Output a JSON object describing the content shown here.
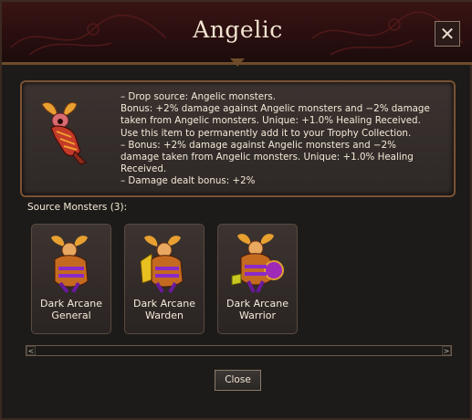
{
  "dialog": {
    "title": "Angelic",
    "close_icon": "close-icon"
  },
  "item": {
    "icon": "angelic-trophy-icon",
    "description_lines": [
      "– Drop source: Angelic monsters.",
      "Bonus: +2% damage against Angelic monsters and −2% damage",
      "taken from Angelic monsters. Unique: +1.0% Healing Received.",
      "Use this item to permanently add it to your Trophy Collection.",
      "– Bonus: +2% damage against Angelic monsters and −2%",
      "damage taken from Angelic monsters. Unique: +1.0% Healing",
      "Received.",
      "– Damage dealt bonus: +2%"
    ]
  },
  "source_monsters": {
    "label": "Source Monsters (3):",
    "items": [
      {
        "name_line1": "Dark Arcane",
        "name_line2": "General",
        "icon": "dark-arcane-general-icon"
      },
      {
        "name_line1": "Dark Arcane",
        "name_line2": "Warden",
        "icon": "dark-arcane-warden-icon"
      },
      {
        "name_line1": "Dark Arcane",
        "name_line2": "Warrior",
        "icon": "dark-arcane-warrior-icon"
      }
    ]
  },
  "footer": {
    "close_label": "Close"
  },
  "colors": {
    "title_bar": "#2a0e0f",
    "panel_border": "#7a5234",
    "text": "#f4ead8"
  }
}
